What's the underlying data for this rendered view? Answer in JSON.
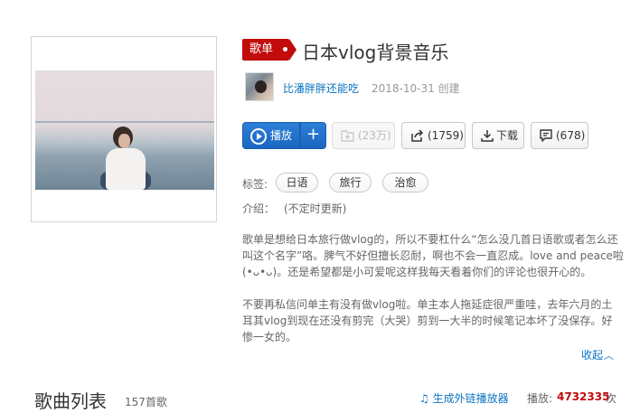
{
  "playlist": {
    "badge": "歌单",
    "title": "日本vlog背景音乐",
    "creator": "比潘胖胖还能吃",
    "created": "2018-10-31 创建"
  },
  "actions": {
    "play": "播放",
    "add": "+",
    "favorite": "(23万)",
    "share": "(1759)",
    "download": "下载",
    "comment": "(678)"
  },
  "tags": {
    "label": "标签:",
    "items": [
      "日语",
      "旅行",
      "治愈"
    ]
  },
  "intro": {
    "label": "介绍：",
    "text": "(不定时更新)"
  },
  "description": {
    "p1": [
      "歌单是想给日本旅行做vlog的，所以不要杠什么“怎么没几首日语歌或者怎么还",
      "叫这个名字”咯。脾气不好但擅长忍耐，啊也不会一直忍成。love and peace啦",
      "(•ᴗ•ᴗ)。还是希望都是小可爱呢这样我每天看着你们的评论也很开心的。"
    ],
    "p2": [
      "不要再私信问单主有没有做vlog啦。单主本人拖延症很严重哇，去年六月的土",
      "耳其vlog到现在还没有剪完（大哭）剪到一大半的时候笔记本坏了没保存。好",
      "惨一女的。"
    ],
    "collapse": "收起"
  },
  "songlist": {
    "title": "歌曲列表",
    "count": "157首歌",
    "external_player": "生成外链播放器",
    "play_count_label": "播放:",
    "play_count": "4732335",
    "play_count_unit": "次"
  },
  "colors": {
    "brand_red": "#c20c0c",
    "link_blue": "#0c73c2",
    "play_blue": "#1a66c0"
  }
}
